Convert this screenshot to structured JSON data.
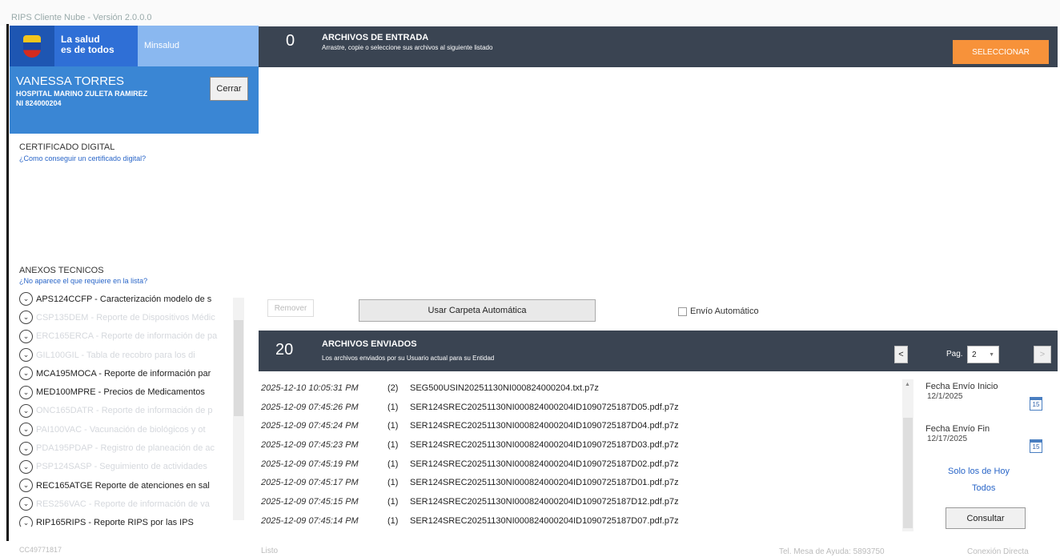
{
  "window": {
    "title": "RIPS Cliente Nube - Versión 2.0.0.0"
  },
  "brand": {
    "slogan_line1": "La salud",
    "slogan_line2": "es de todos",
    "ministry": "Minsalud",
    "logo_icon": "colombia-coat-of-arms-icon"
  },
  "user": {
    "name": "VANESSA TORRES",
    "organization": "HOSPITAL MARINO ZULETA RAMIREZ",
    "ni": "NI 824000204",
    "close_label": "Cerrar"
  },
  "certificate": {
    "title": "CERTIFICADO DIGITAL",
    "help_link": "¿Como conseguir un certificado digital?"
  },
  "annexes": {
    "title": "ANEXOS TECNICOS",
    "help_link": "¿No aparece el que requiere en la lista?",
    "items": [
      {
        "label": "APS124CCFP - Caracterización modelo de s",
        "faded": false
      },
      {
        "label": "CSP135DEM - Reporte de Dispositivos Médic",
        "faded": true
      },
      {
        "label": "ERC165ERCA - Reporte de información de pa",
        "faded": true
      },
      {
        "label": "GIL100GIL - Tabla de recobro para los di",
        "faded": true
      },
      {
        "label": "MCA195MOCA - Reporte de información par",
        "faded": false
      },
      {
        "label": "MED100MPRE - Precios de Medicamentos",
        "faded": false
      },
      {
        "label": "ONC165DATR - Reporte de información de p",
        "faded": true
      },
      {
        "label": "PAI100VAC - Vacunación de biológicos y ot",
        "faded": true
      },
      {
        "label": "PDA195PDAP - Registro de planeación de ac",
        "faded": true
      },
      {
        "label": "PSP124SASP - Seguimiento de actividades",
        "faded": true
      },
      {
        "label": "REC165ATGE Reporte de atenciones en sal",
        "faded": false
      },
      {
        "label": "RES256VAC - Reporte de información de va",
        "faded": true
      },
      {
        "label": "RIP165RIPS - Reporte RIPS por las IPS",
        "faded": false
      }
    ]
  },
  "incoming": {
    "count": "0",
    "title": "ARCHIVOS DE ENTRADA",
    "subtitle": "Arrastre, copie o seleccione sus archivos al siguiente listado",
    "select_label": "SELECCIONAR"
  },
  "actions": {
    "remove_label": "Remover",
    "auto_folder_label": "Usar Carpeta Automática",
    "auto_send_label": "Envío Automático",
    "auto_send_checked": false
  },
  "sent": {
    "count": "20",
    "title": "ARCHIVOS ENVIADOS",
    "subtitle": "Los archivos enviados por su Usuario actual para su Entidad",
    "prev_label": "<",
    "next_label": ">",
    "page_label": "Pag.",
    "page_value": "2",
    "rows": [
      {
        "date": "2025-12-10 10:05:31 PM",
        "count": "(2)",
        "name": "SEG500USIN20251130NI000824000204.txt.p7z"
      },
      {
        "date": "2025-12-09 07:45:26 PM",
        "count": "(1)",
        "name": "SER124SREC20251130NI000824000204ID1090725187D05.pdf.p7z"
      },
      {
        "date": "2025-12-09 07:45:24 PM",
        "count": "(1)",
        "name": "SER124SREC20251130NI000824000204ID1090725187D04.pdf.p7z"
      },
      {
        "date": "2025-12-09 07:45:23 PM",
        "count": "(1)",
        "name": "SER124SREC20251130NI000824000204ID1090725187D03.pdf.p7z"
      },
      {
        "date": "2025-12-09 07:45:19 PM",
        "count": "(1)",
        "name": "SER124SREC20251130NI000824000204ID1090725187D02.pdf.p7z"
      },
      {
        "date": "2025-12-09 07:45:17 PM",
        "count": "(1)",
        "name": "SER124SREC20251130NI000824000204ID1090725187D01.pdf.p7z"
      },
      {
        "date": "2025-12-09 07:45:15 PM",
        "count": "(1)",
        "name": "SER124SREC20251130NI000824000204ID1090725187D12.pdf.p7z"
      },
      {
        "date": "2025-12-09 07:45:14 PM",
        "count": "(1)",
        "name": "SER124SREC20251130NI000824000204ID1090725187D07.pdf.p7z"
      }
    ]
  },
  "filters": {
    "start_label": "Fecha Envío Inicio",
    "start_value": "12/1/2025",
    "end_label": "Fecha Envío Fin",
    "end_value": "12/17/2025",
    "calendar_day": "15",
    "today_link": "Solo los de Hoy",
    "all_link": "Todos",
    "query_label": "Consultar"
  },
  "status": {
    "left_code": "CC49771817",
    "state": "Listo",
    "help_desk": "Tel. Mesa de Ayuda: 5893750",
    "connection": "Conexión Directa"
  },
  "colors": {
    "header_bar": "#3a4452",
    "brand_blue": "#1e56b2",
    "user_panel": "#3a86d4",
    "accent_orange": "#f7923a",
    "link_blue": "#2a66c8"
  }
}
